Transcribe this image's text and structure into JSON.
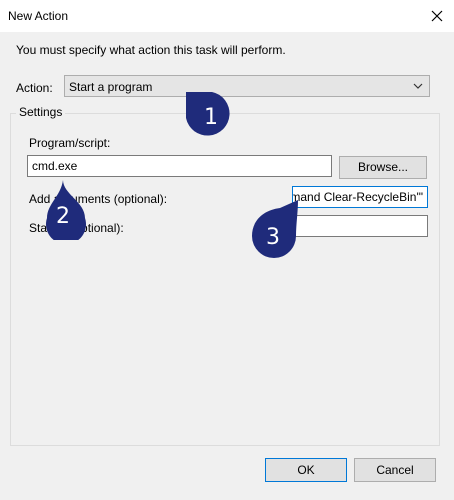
{
  "window": {
    "title": "New Action"
  },
  "instruction": "You must specify what action this task will perform.",
  "action": {
    "label": "Action:",
    "selected": "Start a program"
  },
  "settings": {
    "legend": "Settings",
    "program_label": "Program/script:",
    "program_value": "cmd.exe",
    "browse_label": "Browse...",
    "args_label": "Add arguments (optional):",
    "args_value": "mand Clear-RecycleBin'\"",
    "start_label": "Start in (optional):",
    "start_value": ""
  },
  "buttons": {
    "ok": "OK",
    "cancel": "Cancel"
  },
  "annotations": [
    {
      "number": "1",
      "color": "#1f2b7b"
    },
    {
      "number": "2",
      "color": "#1f2b7b"
    },
    {
      "number": "3",
      "color": "#1f2b7b"
    }
  ]
}
